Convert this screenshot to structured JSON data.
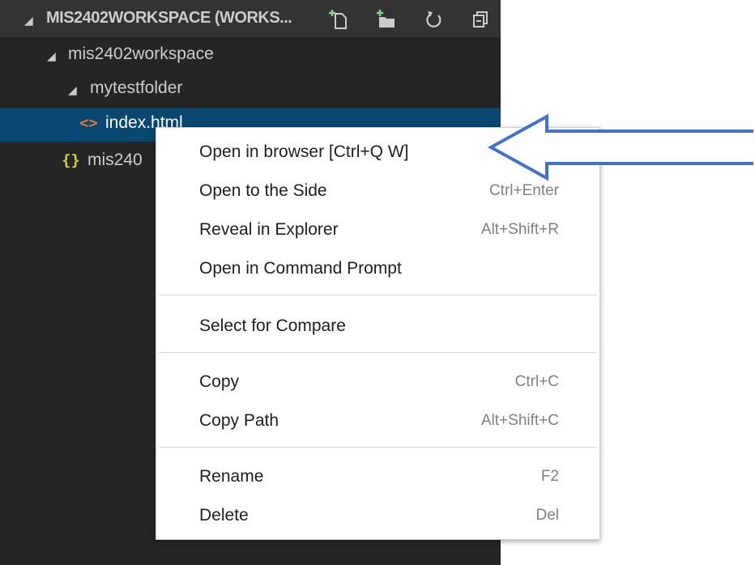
{
  "explorer": {
    "header": {
      "title": "MIS2402WORKSPACE (WORKS...",
      "buttons": [
        "new-file-icon",
        "new-folder-icon",
        "refresh-icon",
        "collapse-all-icon"
      ]
    },
    "tree": [
      {
        "label": "mis2402workspace",
        "type": "folder",
        "expanded": true
      },
      {
        "label": "mytestfolder",
        "type": "folder",
        "expanded": true
      },
      {
        "label": "index.html",
        "type": "html-file",
        "selected": true,
        "icon_text": "<>"
      },
      {
        "label": "mis240",
        "type": "json-file",
        "icon_text": "{}"
      }
    ],
    "twisty_glyph": "◢"
  },
  "context_menu": {
    "groups": [
      [
        {
          "label": "Open in browser [Ctrl+Q W]",
          "shortcut": ""
        },
        {
          "label": "Open to the Side",
          "shortcut": "Ctrl+Enter"
        },
        {
          "label": "Reveal in Explorer",
          "shortcut": "Alt+Shift+R"
        },
        {
          "label": "Open in Command Prompt",
          "shortcut": ""
        }
      ],
      [
        {
          "label": "Select for Compare",
          "shortcut": ""
        }
      ],
      [
        {
          "label": "Copy",
          "shortcut": "Ctrl+C"
        },
        {
          "label": "Copy Path",
          "shortcut": "Alt+Shift+C"
        }
      ],
      [
        {
          "label": "Rename",
          "shortcut": "F2"
        },
        {
          "label": "Delete",
          "shortcut": "Del"
        }
      ]
    ]
  },
  "annotation": {
    "type": "arrow",
    "points_to": "Open in browser [Ctrl+Q W]",
    "color": "#4472c4"
  },
  "colors": {
    "sidebar_bg": "#252526",
    "header_bg": "#333333",
    "selection": "#094771",
    "html_icon": "#e37933",
    "json_icon": "#cbcb41",
    "green_plus": "#89d185"
  }
}
